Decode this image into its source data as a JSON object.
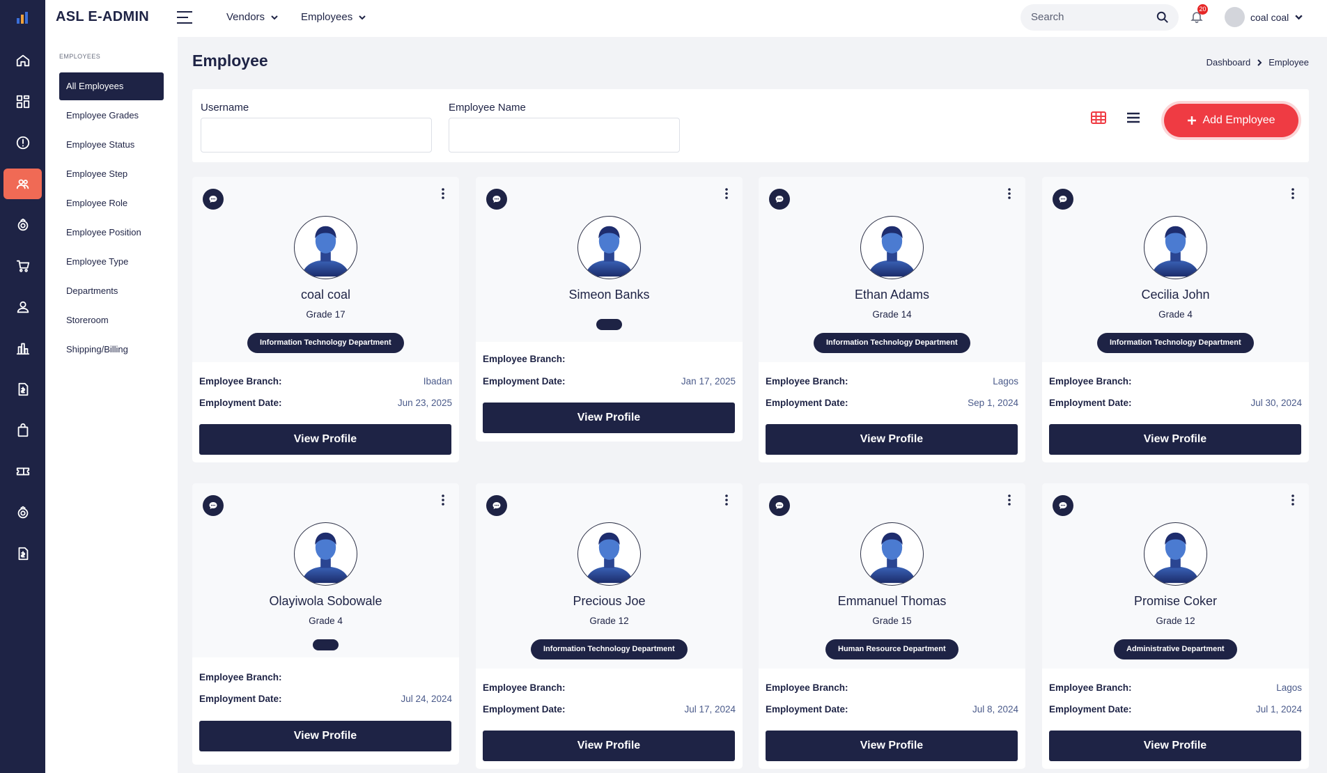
{
  "app": {
    "title": "ASL E-ADMIN"
  },
  "topnav": [
    {
      "label": "Vendors"
    },
    {
      "label": "Employees"
    }
  ],
  "search": {
    "placeholder": "Search"
  },
  "notifications": {
    "count": "20"
  },
  "user": {
    "name": "coal coal"
  },
  "sidebar": {
    "section": "EMPLOYEES",
    "items": [
      {
        "label": "All Employees",
        "active": true
      },
      {
        "label": "Employee Grades"
      },
      {
        "label": "Employee Status"
      },
      {
        "label": "Employee Step"
      },
      {
        "label": "Employee Role"
      },
      {
        "label": "Employee Position"
      },
      {
        "label": "Employee Type"
      },
      {
        "label": "Departments"
      },
      {
        "label": "Storeroom"
      },
      {
        "label": "Shipping/Billing"
      }
    ]
  },
  "rail_icons": [
    "home-icon",
    "dashboard-icon",
    "alert-icon",
    "users-icon",
    "badge-icon",
    "cart-icon",
    "person-icon",
    "chart-icon",
    "invoice-icon",
    "bag-icon",
    "ticket-icon",
    "badge-icon-2",
    "document-icon"
  ],
  "page": {
    "title": "Employee",
    "breadcrumb": [
      "Dashboard",
      "Employee"
    ]
  },
  "filters": {
    "username_label": "Username",
    "username_value": "",
    "employee_name_label": "Employee Name",
    "employee_name_value": "",
    "add_button": "Add Employee"
  },
  "labels": {
    "branch": "Employee Branch:",
    "date": "Employment Date:",
    "view_profile": "View Profile"
  },
  "employees": [
    {
      "name": "coal coal",
      "grade": "Grade 17",
      "department": "Information Technology Department",
      "branch": "Ibadan",
      "date": "Jun 23, 2025"
    },
    {
      "name": "Simeon Banks",
      "grade": "",
      "department": "",
      "branch": "",
      "date": "Jan 17, 2025"
    },
    {
      "name": "Ethan Adams",
      "grade": "Grade 14",
      "department": "Information Technology Department",
      "branch": "Lagos",
      "date": "Sep 1, 2024"
    },
    {
      "name": "Cecilia John",
      "grade": "Grade 4",
      "department": "Information Technology Department",
      "branch": "",
      "date": "Jul 30, 2024"
    },
    {
      "name": "Olayiwola Sobowale",
      "grade": "Grade 4",
      "department": "",
      "branch": "",
      "date": "Jul 24, 2024"
    },
    {
      "name": "Precious Joe",
      "grade": "Grade 12",
      "department": "Information Technology Department",
      "branch": "",
      "date": "Jul 17, 2024"
    },
    {
      "name": "Emmanuel Thomas",
      "grade": "Grade 15",
      "department": "Human Resource Department",
      "branch": "",
      "date": "Jul 8, 2024"
    },
    {
      "name": "Promise Coker",
      "grade": "Grade 12",
      "department": "Administrative Department",
      "branch": "Lagos",
      "date": "Jul 1, 2024"
    }
  ],
  "colors": {
    "navy": "#1e2345",
    "accent_red": "#ef3b43",
    "active_rail": "#f06a55"
  }
}
